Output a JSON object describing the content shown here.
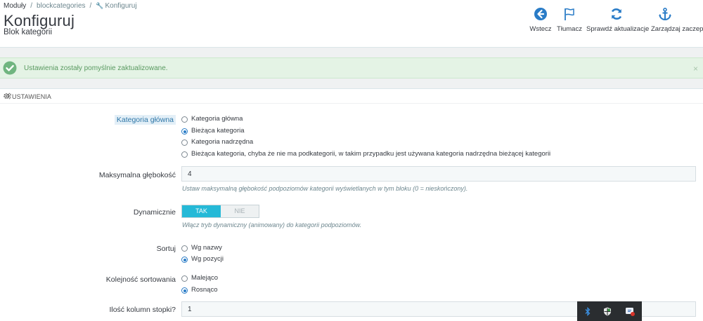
{
  "breadcrumb": {
    "level1": "Moduły",
    "level2": "blockcategories",
    "level3": "Konfiguruj"
  },
  "header": {
    "title": "Konfiguruj",
    "subtitle": "Blok kategorii"
  },
  "toolbar": {
    "back": "Wstecz",
    "translate": "Tłumacz",
    "check_update": "Sprawdź aktualizacje",
    "manage_hooks": "Zarządzaj zaczepami"
  },
  "alert": {
    "message": "Ustawienia zostały pomyślnie zaktualizowane.",
    "close": "×"
  },
  "panel": {
    "title": "USTAWIENIA"
  },
  "form": {
    "root_category": {
      "label": "Kategoria główna",
      "options": [
        {
          "label": "Kategoria główna",
          "checked": false
        },
        {
          "label": "Bieżąca kategoria",
          "checked": true
        },
        {
          "label": "Kategoria nadrzędna",
          "checked": false
        },
        {
          "label": "Bieżąca kategoria, chyba że nie ma podkategorii, w takim przypadku jest używana kategoria nadrzędna bieżącej kategorii",
          "checked": false
        }
      ]
    },
    "max_depth": {
      "label": "Maksymalna głębokość",
      "value": "4",
      "help": "Ustaw maksymalną głębokość podpoziomów kategorii wyświetlanych w tym bloku (0 = nieskończony)."
    },
    "dynamic": {
      "label": "Dynamicznie",
      "on": "TAK",
      "off": "NIE",
      "value": "TAK",
      "help": "Włącz tryb dynamiczny (animowany) do kategorii podpoziomów."
    },
    "sort": {
      "label": "Sortuj",
      "options": [
        {
          "label": "Wg nazwy",
          "checked": false
        },
        {
          "label": "Wg pozycji",
          "checked": true
        }
      ]
    },
    "sort_order": {
      "label": "Kolejność sortowania",
      "options": [
        {
          "label": "Malejąco",
          "checked": false
        },
        {
          "label": "Rosnąco",
          "checked": true
        }
      ]
    },
    "footer_columns": {
      "label": "Ilość kolumn stopki?",
      "value": "1"
    }
  },
  "colors": {
    "accent": "#25b9d7",
    "success": "#70b580",
    "primary_icon": "#2a7cc7"
  }
}
